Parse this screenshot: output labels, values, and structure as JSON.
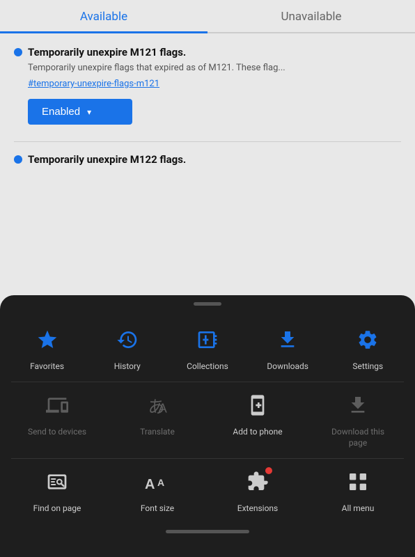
{
  "tabs": {
    "available": "Available",
    "unavailable": "Unavailable"
  },
  "flags": [
    {
      "id": "flag1",
      "title": "Temporarily unexpire M121 flags.",
      "description": "Temporarily unexpire flags that expired as of M121. These flag...",
      "link": "#temporary-unexpire-flags-m121",
      "dropdown_label": "Enabled"
    },
    {
      "id": "flag2",
      "title": "Temporarily unexpire M122 flags.",
      "description": "",
      "link": "",
      "dropdown_label": ""
    }
  ],
  "sheet": {
    "row1": [
      {
        "id": "favorites",
        "label": "Favorites",
        "icon": "star",
        "active": true,
        "dimmed": false
      },
      {
        "id": "history",
        "label": "History",
        "icon": "history",
        "active": false,
        "dimmed": false
      },
      {
        "id": "collections",
        "label": "Collections",
        "icon": "collections",
        "active": false,
        "dimmed": false
      },
      {
        "id": "downloads",
        "label": "Downloads",
        "icon": "downloads",
        "active": false,
        "dimmed": false
      },
      {
        "id": "settings",
        "label": "Settings",
        "icon": "settings",
        "active": false,
        "dimmed": false
      }
    ],
    "row2": [
      {
        "id": "send-to-devices",
        "label": "Send to devices",
        "icon": "send",
        "active": false,
        "dimmed": true
      },
      {
        "id": "translate",
        "label": "Translate",
        "icon": "translate",
        "active": false,
        "dimmed": true
      },
      {
        "id": "add-to-phone",
        "label": "Add to phone",
        "icon": "addphone",
        "active": false,
        "dimmed": false
      },
      {
        "id": "download-page",
        "label": "Download this page",
        "icon": "download",
        "active": false,
        "dimmed": true
      }
    ],
    "row3": [
      {
        "id": "find-on-page",
        "label": "Find on page",
        "icon": "find",
        "active": false,
        "dimmed": false
      },
      {
        "id": "font-size",
        "label": "Font size",
        "icon": "fontsize",
        "active": false,
        "dimmed": false
      },
      {
        "id": "extensions",
        "label": "Extensions",
        "icon": "extensions",
        "active": false,
        "dimmed": false,
        "badge": true
      },
      {
        "id": "all-menu",
        "label": "All menu",
        "icon": "allmenu",
        "active": false,
        "dimmed": false
      }
    ]
  }
}
